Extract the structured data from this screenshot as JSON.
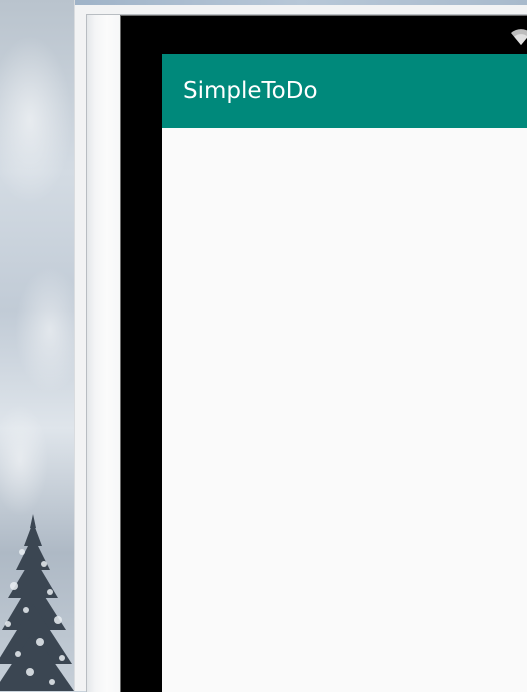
{
  "app": {
    "title": "SimpleToDo",
    "toolbar_color": "#00897b",
    "background_color": "#fafafa"
  },
  "status_bar": {
    "icons": [
      "wifi-icon"
    ]
  },
  "desktop": {
    "wallpaper": "snowy-pine-tree"
  }
}
